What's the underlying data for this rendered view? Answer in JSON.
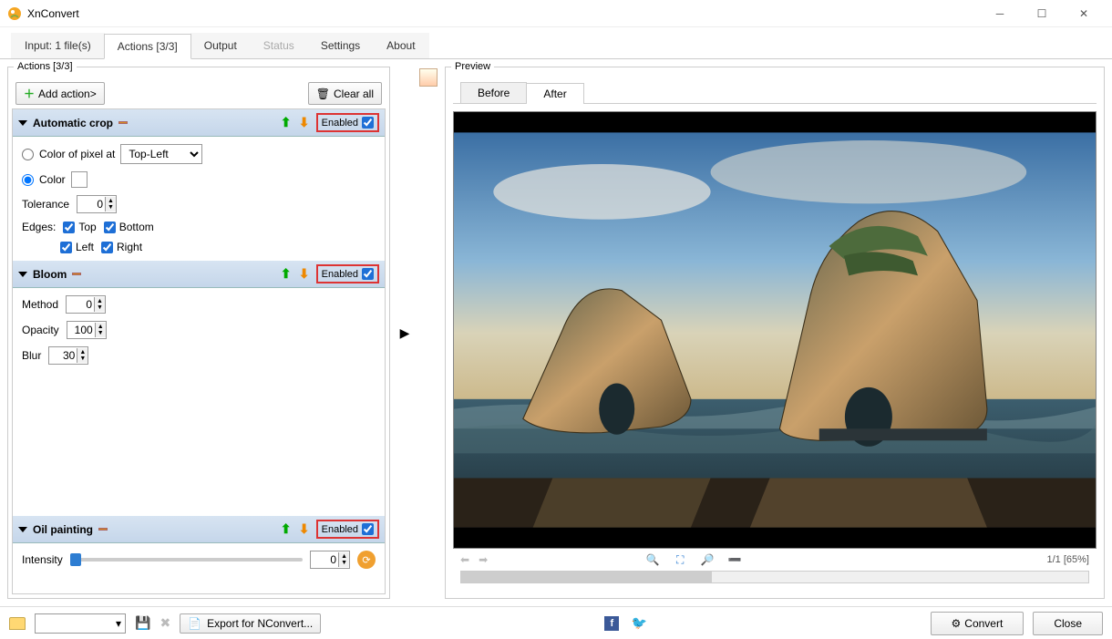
{
  "window": {
    "title": "XnConvert"
  },
  "mainTabs": [
    "Input: 1 file(s)",
    "Actions [3/3]",
    "Output",
    "Status",
    "Settings",
    "About"
  ],
  "mainTabActive": 1,
  "actionsPanel": {
    "title": "Actions [3/3]",
    "addButton": "Add action>",
    "clearButton": "Clear all",
    "enabledLabel": "Enabled"
  },
  "actions": [
    {
      "name": "Automatic crop",
      "fields": {
        "colorOfPixelLabel": "Color of pixel at",
        "pixelPos": "Top-Left",
        "colorLabel": "Color",
        "color": "#ffffff",
        "toleranceLabel": "Tolerance",
        "tolerance": 0,
        "edgesLabel": "Edges:",
        "edges": {
          "top": "Top",
          "bottom": "Bottom",
          "left": "Left",
          "right": "Right"
        }
      }
    },
    {
      "name": "Bloom",
      "fields": {
        "methodLabel": "Method",
        "method": 0,
        "opacityLabel": "Opacity",
        "opacity": 100,
        "blurLabel": "Blur",
        "blur": 30
      }
    },
    {
      "name": "Oil painting",
      "fields": {
        "intensityLabel": "Intensity",
        "intensity": 0
      }
    }
  ],
  "preview": {
    "title": "Preview",
    "tabs": [
      "Before",
      "After"
    ],
    "activeTab": 1,
    "status": "1/1 [65%]"
  },
  "bottom": {
    "export": "Export for NConvert...",
    "convert": "Convert",
    "close": "Close"
  }
}
